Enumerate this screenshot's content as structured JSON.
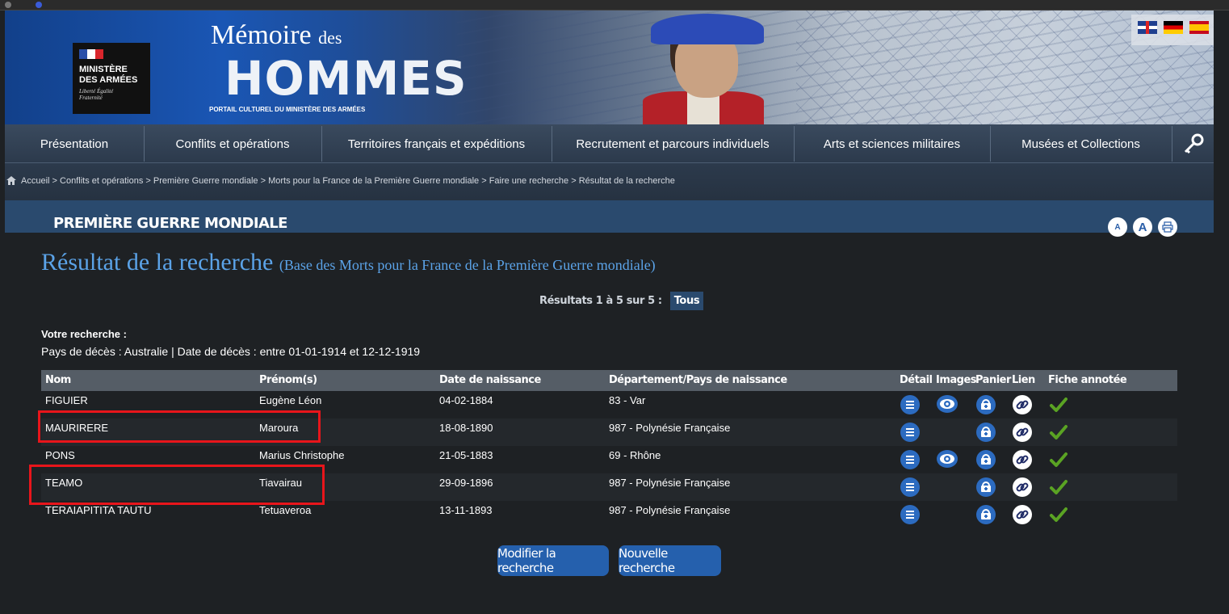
{
  "banner": {
    "ministry_line1": "MINISTÈRE",
    "ministry_line2": "DES ARMÉES",
    "ministry_motto": "Liberté Égalité Fraternité",
    "logo_top": "Mémoire",
    "logo_top_small": "des",
    "logo_main": "HOMMES",
    "logo_subtitle": "PORTAIL CULTUREL DU MINISTÈRE DES ARMÉES"
  },
  "nav": {
    "items": [
      "Présentation",
      "Conflits et opérations",
      "Territoires français et expéditions",
      "Recrutement et parcours individuels",
      "Arts et sciences militaires",
      "Musées et Collections"
    ]
  },
  "breadcrumb": {
    "items": [
      "Accueil",
      "Conflits et opérations",
      "Première Guerre mondiale",
      "Morts pour la France de la Première Guerre mondiale",
      "Faire une recherche",
      "Résultat de la recherche"
    ],
    "separator": " > "
  },
  "section": {
    "title": "PREMIÈRE GUERRE MONDIALE",
    "tools": {
      "font_small": "A",
      "font_large": "A"
    }
  },
  "results": {
    "title": "Résultat de la recherche",
    "subtitle": "(Base des Morts pour la France de la Première Guerre mondiale)",
    "pager_label": "Résultats 1 à 5 sur 5 :",
    "pager_all": "Tous",
    "query_title": "Votre recherche :",
    "query_text": "Pays de décès : Australie | Date de décès : entre 01-01-1914 et 12-12-1919"
  },
  "table": {
    "headers": [
      "Nom",
      "Prénom(s)",
      "Date de naissance",
      "Département/Pays de naissance",
      "Détail",
      "Images",
      "Panier",
      "Lien",
      "Fiche annotée"
    ],
    "rows": [
      {
        "nom": "FIGUIER",
        "prenom": "Eugène Léon",
        "naissance": "04-02-1884",
        "departement": "83 - Var",
        "has_image": true
      },
      {
        "nom": "MAURIRERE",
        "prenom": "Maroura",
        "naissance": "18-08-1890",
        "departement": "987 - Polynésie Française",
        "has_image": false
      },
      {
        "nom": "PONS",
        "prenom": "Marius Christophe",
        "naissance": "21-05-1883",
        "departement": "69 - Rhône",
        "has_image": true
      },
      {
        "nom": "TEAMO",
        "prenom": "Tiavairau",
        "naissance": "29-09-1896",
        "departement": "987 - Polynésie Française",
        "has_image": false
      },
      {
        "nom": "TERAIAPITITA TAUTU",
        "prenom": "Tetuaveroa",
        "naissance": "13-11-1893",
        "departement": "987 - Polynésie Française",
        "has_image": false
      }
    ]
  },
  "actions": {
    "modify": "Modifier la recherche",
    "new": "Nouvelle recherche"
  },
  "colors": {
    "accent_blue": "#2560ad",
    "title_blue": "#5ba3e8",
    "highlight_red": "#e8151b",
    "check_green": "#5aa323"
  }
}
